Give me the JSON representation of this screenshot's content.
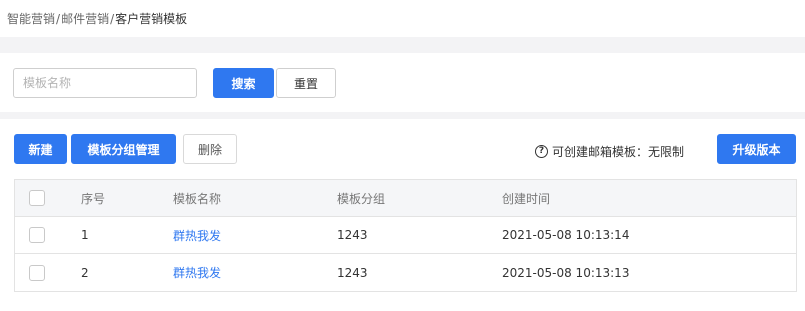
{
  "breadcrumb": {
    "items": [
      "智能营销",
      "邮件营销",
      "客户营销模板"
    ],
    "separator": "/"
  },
  "search": {
    "placeholder": "模板名称",
    "value": "",
    "search_label": "搜索",
    "reset_label": "重置"
  },
  "toolbar": {
    "new_label": "新建",
    "group_manage_label": "模板分组管理",
    "delete_label": "删除",
    "quota_text": "可创建邮箱模板：无限制",
    "upgrade_label": "升级版本",
    "help_icon": "question-circle-icon"
  },
  "table": {
    "headers": {
      "index": "序号",
      "name": "模板名称",
      "group": "模板分组",
      "created": "创建时间"
    },
    "rows": [
      {
        "index": "1",
        "name": "群热我发",
        "group": "1243",
        "created": "2021-05-08 10:13:14"
      },
      {
        "index": "2",
        "name": "群热我发",
        "group": "1243",
        "created": "2021-05-08 10:13:13"
      }
    ]
  },
  "colors": {
    "primary": "#2f78f0",
    "page_bg": "#f3f3f5",
    "header_bg": "#f5f6f8"
  }
}
